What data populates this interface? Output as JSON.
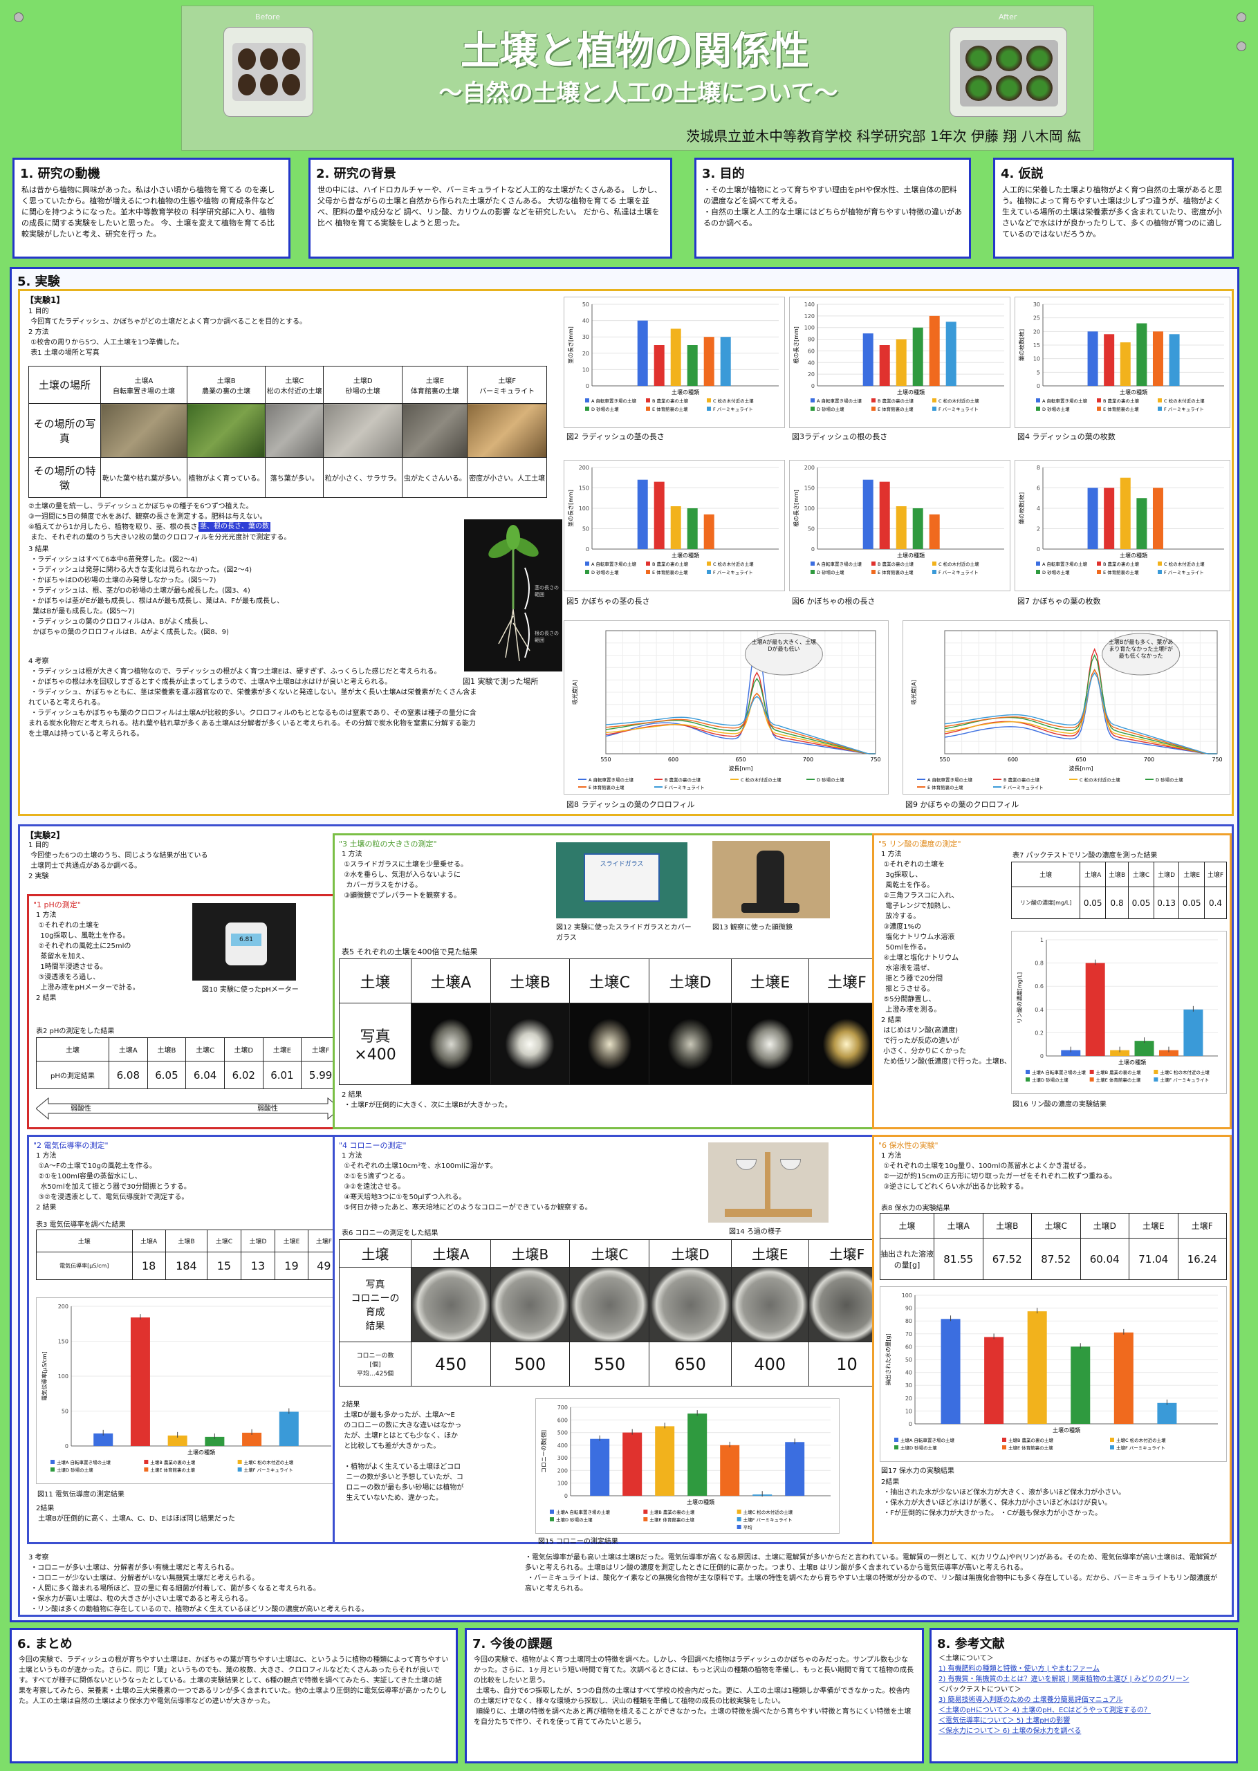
{
  "header": {
    "title": "土壌と植物の関係性",
    "subtitle": "～自然の土壌と人工の土壌について～",
    "author_line": "茨城県立並木中等教育学校 科学研究部 1年次 伊藤 翔 八木岡 紘",
    "before_label": "Before",
    "after_label": "After"
  },
  "sec1": {
    "title": "1. 研究の動機",
    "text": "私は昔から植物に興味があった。私は小さい頃から植物を育てる のを楽しく思っていたから。植物が増えるにつれ植物の生態や植物 の育成条件などに関心を持つようになった。並木中等教育学校の 科学研究部に入り、植物の成長に関する実験をしたいと思った。 今、土壌を変えて植物を育てる比較実験がしたいと考え、研究を行っ た。"
  },
  "sec2": {
    "title": "2. 研究の背景",
    "text": "世の中には、ハイドロカルチャーや、バーミキュライトなど人工的な土壌がたくさんある。 しかし、父母から昔ながらの土壌と自然から作られた土壌がたくさんある。 大切な植物を育てる 土壌を並べ、肥料の量や成分など 調べ、リン酸、カリウムの影響 などを研究したい。 だから、私達は土壌を比べ 植物を育てる実験をしようと思った。"
  },
  "sec3": {
    "title": "3. 目的",
    "text": "・その土壌が植物にとって育ちやすい理由をpHや保水性、土壌自体の肥料の濃度などを調べて考える。\n・自然の土壌と人工的な土壌にはどちらが植物が育ちやすい特徴の違いがあるのか調べる。"
  },
  "sec4": {
    "title": "4. 仮説",
    "text": "人工的に栄養した土壌より植物がよく育つ自然の土壌があると思う。植物によって育ちやすい土壌は少しずつ違うが、植物がよく生えている場所の土壌は栄養素が多く含まれていたり、密度が小さいなどで水はけが良かったりして、多くの植物が育つのに適しているのではないだろうか。"
  },
  "sec5": {
    "title": "5. 実験",
    "exp1_label": "【実験1】",
    "exp1_intro": "1 目的\n 今回育てたラディッシュ、かぼちゃがどの土壌だとよく育つか調べることを目的とする。\n2 方法\n ①校舎の周りから5つ、人工土壌を1つ準備した。\n 表1 土壌の場所と写真",
    "table1": {
      "row_labels": [
        "土壌の場所",
        "その場所の写真",
        "その場所の特徴"
      ],
      "cols": [
        {
          "name": "土壌A\n自転車置き場の土壌",
          "feature": "乾いた葉や枯れ葉が多い。"
        },
        {
          "name": "土壌B\n農業の裏の土壌",
          "feature": "植物がよく育っている。"
        },
        {
          "name": "土壌C\n松の木付近の土壌",
          "feature": "落ち葉が多い。"
        },
        {
          "name": "土壌D\n砂場の土壌",
          "feature": "粒が小さく、サラサラ。"
        },
        {
          "name": "土壌E\n体育館裏の土壌",
          "feature": "虫がたくさんいる。"
        },
        {
          "name": "土壌F\nバーミキュライト",
          "feature": "密度が小さい。人工土壌"
        }
      ]
    },
    "exp1_method2": "②土壌の量を統一し、ラディッシュとかぼちゃの種子を6つずつ植えた。\n③一週間に5日の頻度で水をあげ、観察の長さを測定する。肥料は与えない。\n④植えてから1か月したら、植物を取り、茎、根の長さ、葉の数を比較する。\n また、それぞれの葉のうち大きい2枚の葉のクロロフィルを分光光度計で測定する。",
    "highlight": "茎、根の長さ、葉の数",
    "exp1_result": "3 結果\n ・ラディッシュはすべて6本中6苗発芽した。(図2～4)\n ・ラディッシュは発芽に関わる大きな変化は見られなかった。(図2～4)\n ・かぼちゃはDの砂場の土壌のみ発芽しなかった。(図5～7)\n ・ラディッシュは、根、茎がDの砂場の土壌が最も成長した。(図3、4)\n ・かぼちゃは茎がEが最も成長し、根はAが最も成長し、葉はA、Fが最も成長し、\n  葉はBが最も成長した。(図5～7)\n ・ラディッシュの葉のクロロフィルはA、Bがよく成長し、\n  かぼちゃの葉のクロロフィルはB、Aがよく成長した。(図8、9)",
    "exp1_discussion": "4 考察\n ・ラディッシュは根が大きく育つ植物なので、ラディッシュの根がよく育つ土壌Eは、硬すぎず、ふっくらした感じだと考えられる。\n ・かぼちゃの根は水を回収しすぎるとすぐ成長が止まってしまうので、土壌Aや土壌Bは水はけが良いと考えられる。\n ・ラディッシュ、かぼちゃともに、茎は栄養素を運ぶ器官なので、栄養素が多くないと発達しない。茎が太く長い土壌Aは栄養素がたくさん含まれていると考えられる。\n ・ラディッシュもかぼちゃも葉のクロロフィルは土壌Aが比較的多い。クロロフィルのもととなるものは窒素であり、その窒素は種子の量分に含まれる炭水化物だと考えられる。枯れ葉や枯れ草が多くある土壌Aは分解者が多くいると考えられる。その分解で炭水化物を窒素に分解する能力を土壌Aは持っていると考えられる。",
    "fig1_caption": "図1 実験で測った場所",
    "fig1_label_stem": "茎の長さの範囲",
    "fig1_label_root": "根の長さの範囲"
  },
  "charts_exp1": {
    "xlabel": "土壌の種類",
    "legend": [
      "A 自転車置き場の土壌",
      "B 農業の裏の土壌",
      "C 松の木付近の土壌",
      "D 砂場の土壌",
      "E 体育館裏の土壌",
      "F バーミキュライト"
    ],
    "colors": [
      "#3b6ee0",
      "#e0322e",
      "#f2b21c",
      "#2f9a3f",
      "#f06a1e",
      "#3a9ad8"
    ],
    "fig2": {
      "caption": "図2 ラディッシュの茎の長さ",
      "ylabel": "茎の長さ[mm]",
      "ymax": 50,
      "ticks": [
        0,
        10,
        20,
        30,
        40,
        50
      ],
      "values": [
        40,
        25,
        35,
        25,
        30,
        30
      ]
    },
    "fig3": {
      "caption": "図3ラディッシュの根の長さ",
      "ylabel": "根の長さ[mm]",
      "ymax": 140,
      "ticks": [
        0,
        20,
        40,
        60,
        80,
        100,
        120,
        140
      ],
      "values": [
        90,
        70,
        80,
        100,
        120,
        110
      ]
    },
    "fig4": {
      "caption": "図4 ラディッシュの葉の枚数",
      "ylabel": "葉の枚数[枚]",
      "ymax": 30,
      "ticks": [
        0,
        5,
        10,
        15,
        20,
        25,
        30
      ],
      "values": [
        20,
        19,
        16,
        23,
        20,
        19
      ]
    },
    "fig5": {
      "caption": "図5 かぼちゃの茎の長さ",
      "ylabel": "茎の長さ[mm]",
      "ymax": 200,
      "ticks": [
        0,
        50,
        100,
        150,
        200
      ],
      "values": [
        170,
        165,
        105,
        100,
        85,
        0
      ]
    },
    "fig6": {
      "caption": "図6 かぼちゃの根の長さ",
      "ylabel": "根の長さ[mm]",
      "ymax": 200,
      "ticks": [
        0,
        50,
        100,
        150,
        200
      ],
      "values": [
        170,
        165,
        105,
        100,
        85,
        0
      ]
    },
    "fig7": {
      "caption": "図7 かぼちゃの葉の枚数",
      "ylabel": "葉の枚数[枚]",
      "ymax": 8,
      "ticks": [
        0,
        2,
        4,
        6,
        8
      ],
      "values": [
        6,
        6,
        7,
        5,
        6,
        0
      ]
    },
    "fig8": {
      "caption": "図8 ラディッシュの葉のクロロフィル",
      "bubble": "土壌Aが最も大きく、土壌Dが最も低い",
      "xlabel": "波長[nm]",
      "ylabel": "吸光度[A]"
    },
    "fig9": {
      "caption": "図9 かぼちゃの葉のクロロフィル",
      "bubble": "土壌Bが最も多く、葉があまり育たなかった土壌Fが最も低くなかった",
      "xlabel": "波長[nm]",
      "ylabel": "吸光度[A]"
    },
    "spectrum_x_ticks": [
      "550",
      "600",
      "650",
      "700",
      "750"
    ]
  },
  "exp2": {
    "label": "【実験2】",
    "intro": "1 目的\n 今回使った6つの土壌のうち、同じような結果が出ている\n 土壌同士で共通点があるか調べる。\n2 実験",
    "ph": {
      "title": "\"1 pHの測定\"",
      "method": "1 方法\n ①それぞれの土壌を\n  10g採取し、風乾土を作る。\n ②それぞれの風乾土に25mlの\n  蒸留水を加え、\n  1時間半浸透させる。\n ③浸透液をろ過し、\n  上澄み液をpHメーターで計る。\n2 結果",
      "fig10_caption": "図10 実験に使ったpHメーター",
      "meter_display": "6.81",
      "table_caption": "表2 pHの測定をした結果",
      "row_header": "土壌",
      "row_label": "pHの測定結果",
      "cols": [
        "土壌A",
        "土壌B",
        "土壌C",
        "土壌D",
        "土壌E",
        "土壌F"
      ],
      "values": [
        "6.08",
        "6.05",
        "6.04",
        "6.02",
        "6.01",
        "5.99"
      ],
      "arrow_left": "弱酸性",
      "arrow_right": "弱酸性"
    },
    "grain": {
      "title": "\"3 土壌の粒の大きさの測定\"",
      "method": "1 方法\n ①スライドガラスに土壌を少量乗せる。\n ②水を垂らし、気泡が入らないように\n  カバーガラスをかける。\n ③顕微鏡でプレパラートを観察する。",
      "fig12_caption": "図12 実験に使ったスライドガラスとカバーガラス",
      "fig12_label": "スライドガラス",
      "fig13_caption": "図13 観察に使った顕微鏡",
      "table_caption": "表5 それぞれの土壌を400倍で見た結果",
      "row_header": "土壌",
      "row_label": "写真\n×400",
      "cols": [
        "土壌A",
        "土壌B",
        "土壌C",
        "土壌D",
        "土壌E",
        "土壌F"
      ],
      "result": "2 結果\n ・土壌Fが圧倒的に大きく、次に土壌Bが大きかった。"
    },
    "phosphate": {
      "title": "\"5 リン酸の濃度の測定\"",
      "method": "1 方法\n ①それぞれの土壌を\n  3g採取し、\n  風乾土を作る。\n ②三角フラスコに入れ、\n  電子レンジで加熱し、\n  放冷する。\n ③濃度1%の\n  塩化ナトリウム水溶液\n  50mlを作る。\n ④土壌と塩化ナトリウム\n  水溶液を混ぜ、\n  振とう器で20分間\n  振とうさせる。\n ⑤5分間静置し、\n  上澄み液を測る。\n2 結果\n はじめはリン酸(高濃度)\n で行ったが反応の違いが\n 小さく、分かりにくかった\n ため低リン酸(低濃度)で行った。土壌B、Fが大きく反応した。",
      "table_caption": "表7 パックテストでリン酸の濃度を測った結果",
      "row_header": "土壌",
      "row_label": "リン酸の濃度[mg/L]",
      "cols": [
        "土壌A",
        "土壌B",
        "土壌C",
        "土壌D",
        "土壌E",
        "土壌F"
      ],
      "values": [
        "0.05",
        "0.8",
        "0.05",
        "0.13",
        "0.05",
        "0.4"
      ],
      "fig16_caption": "図16 リン酸の濃度の実験結果",
      "ylabel": "リン酸の濃度[mg/L]",
      "xlabel": "土壌の種類"
    },
    "conductivity": {
      "title": "\"2 電気伝導率の測定\"",
      "method": "1 方法\n ①A～Fの土壌で10gの風乾土を作る。\n ②①を100ml容量の蒸留水にし、\n  水50mlを加えて振とう器で30分間振とうする。\n ③②を浸透液として、電気伝導度計で測定する。\n2 結果",
      "table_caption": "表3 電気伝導率を調べた結果",
      "row_header": "土壌",
      "row_label": "電気伝導率[μS/cm]",
      "cols": [
        "土壌A",
        "土壌B",
        "土壌C",
        "土壌D",
        "土壌E",
        "土壌F"
      ],
      "values": [
        "18",
        "184",
        "15",
        "13",
        "19",
        "49"
      ],
      "fig11_caption": "図11 電気伝導度の測定結果",
      "ylabel": "電気伝導率[μS/cm]",
      "xlabel": "土壌の種類",
      "discussion": "2結果\n 土壌Bが圧倒的に高く、土壌A、C、D、Eはほぼ同じ結果だった"
    },
    "colony": {
      "title": "\"4 コロニーの測定\"",
      "method": "1 方法\n ①それぞれの土壌10cm³を、水100mlに溶かす。\n ②①を5滴ずつとる。\n ③②を遠沈させる。\n ④寒天培地3つに①を50μlずつ入れる。\n ⑤何日か待ったあと、寒天培地にどのようなコロニーができているか観察する。",
      "fig14_caption": "図14 ろ過の様子",
      "table_caption": "表6 コロニーの測定をした結果",
      "row_header": "土壌",
      "row_photo": "写真\nコロニーの\n育成\n結果",
      "row_count": "コロニーの数\n[個]\n平均…425個",
      "cols": [
        "土壌A",
        "土壌B",
        "土壌C",
        "土壌D",
        "土壌E",
        "土壌F"
      ],
      "values": [
        "450",
        "500",
        "550",
        "650",
        "400",
        "10"
      ],
      "result": "2結果\n 土壌Dが最も多かったが、土壌A～E\n のコロニーの数に大きな違いはなかっ\n たが、土壌Fとはとても少なく、ほか\n と比較しても差が大きかった。\n\n ・植物がよく生えている土壌ほどコロ\n  ニーの数が多いと予想していたが、コ\n  ロニーの数が最も多い砂場には植物が\n  生えていないため、違かった。",
      "fig15_caption": "図15 コロニーの測定結果",
      "ylabel": "コロニーの数[個]",
      "xlabel": "土壌の種類",
      "avg_label": "平均"
    },
    "water": {
      "title": "\"6 保水性の実験\"",
      "method": "1 方法\n ①それぞれの土壌を10g量り、100mlの蒸留水とよくかき混ぜる。\n ②一辺が約15cmの正方形に切り取ったガーゼをそれぞれ二枚ずつ重ねる。\n ③逆さにしてどれくらい水が出るか比較する。",
      "table_caption": "表8 保水力の実験結果",
      "row_header": "土壌",
      "row_label": "抽出された溶液の量[g]",
      "cols": [
        "土壌A",
        "土壌B",
        "土壌C",
        "土壌D",
        "土壌E",
        "土壌F"
      ],
      "values": [
        "81.55",
        "67.52",
        "87.52",
        "60.04",
        "71.04",
        "16.24"
      ],
      "fig17_caption": "図17 保水力の実験結果",
      "ylabel": "抽出された水の量[g]",
      "xlabel": "土壌の種類",
      "result": "2結果\n ・抽出された水が少ないほど保水力が大きく、液が多いほど保水力が小さい。\n ・保水力が大きいほど水はけが悪く、保水力が小さいほど水はけが良い。\n ・Fが圧倒的に保水力が大きかった。 ・Cが最も保水力が小さかった。"
    },
    "discussion_left": "3 考察\n ・コロニーが多い土壌は、分解者が多い有機土壌だと考えられる。\n ・コロニーが少ない土壌は、分解者がいない無機質土壌だと考えられる。\n ・人間に多く踏まれる場所ほど、豆の量に有る細菌が付着して、菌が多くなると考えられる。\n ・保水力が高い土壌は、粒の大きさが小さい土壌であると考えられる。\n ・リン酸は多くの動植物に存在しているので、植物がよく生えているほどリン酸の濃度が高いと考えられる。",
    "discussion_right": "・電気伝導率が最も高い土壌は土壌Bだった。電気伝導率が高くなる原因は、土壌に電解質が多いからだと言われている。電解質の一例として、K(カリウム)やP(リン)がある。そのため、電気伝導率が高い土壌Bは、電解質が多いと考えられる。土壌Bはリン酸の濃度を測定したときに圧倒的に高かった。つまり、土壌B はリン酸が多く含まれているから電気伝導率が高いと考えられる。\n ・バーミキュライトは、酸化ケイ素などの無機化合物が主な原料です。土壌の特性を調べたから育ちやすい土壌の特徴が分かるので、リン酸は無機化合物中にも多く存在している。だから、バーミキュライトもリン酸濃度が高いと考えられる。"
  },
  "sec6": {
    "title": "6. まとめ",
    "text": "今回の実験で、ラディッシュの根が育ちやすい土壌はE、かぼちゃの葉が育ちやすい土壌はC、というように植物の種類によって育ちやすい土壌というものが違かった。さらに、同じ「葉」というものでも、葉の枚数、大きさ、クロロフィルなどたくさんあったらそれが良いです。すべてが様子に関係ないというなったとしている。土壌の実験結果として、6種の観点で特徴を調べてみたら、実証してきた土壌の結果を考察してみたら、栄養素・土壌の三大栄養素の一つであるリンが多く含まれていた。他の土壌より圧倒的に電気伝導率が高かったりした。人工の土壌は自然の土壌はより保水力や電気伝導率などの違いが大きかった。"
  },
  "sec7": {
    "title": "7. 今後の課題",
    "text": "今回の実験で、植物がよく育つ土壌同士の特徴を調べた。しかし、今回調べた植物はラディッシュのかぼちゃのみだった。サンプル数も少なかった。さらに、1ヶ月という短い時間で育てた。次調べるときには、もっと沢山の種類の植物を準備し、もっと長い期間で育てて植物の成長の比較をしたいと思う。\n 土壌も、自分で6つ採取したが、5つの自然の土壌はすべて学校の校舎内だった。更に、人工の土壌は1種類しか準備ができなかった。校舎内の土壌だけでなく、様々な環境から採取し、沢山の種類を準備して植物の成長の比較実験をしたい。\n 順繰りに、土壌の特徴を調べたあと再び植物を植えることができなかった。土壌の特徴を調べたから育ちやすい特徴と育ちにくい特徴を土壌を自分たちで作り、それを使って育ててみたいと思う。"
  },
  "sec8": {
    "title": "8. 参考文献",
    "refs": [
      "＜土壌について＞",
      "1) 有機肥料の種類と特徴・使い方 | やまむファーム",
      "2) 有機質・無機質の土とは？違いを解説 | 関東植物の土選び | みどりのグリーン",
      "＜パックテストについて＞",
      "3) 簡易技術導入判断のための 土壌養分簡易評価マニュアル",
      "＜土壌のpHについて＞ 4) 土壌のpH、ECはどうやって測定するの？",
      "＜電気伝導率について＞ 5) 土壌pHの影響",
      "＜保水力について＞ 6) 土壌の保水力を調べる"
    ]
  },
  "exp2_charts": {
    "legend": [
      "土壌A 自転車置き場の土壌",
      "土壌B 農業の裏の土壌",
      "土壌C 松の木付近の土壌",
      "土壌D 砂場の土壌",
      "土壌E 体育館裏の土壌",
      "土壌F バーミキュライト"
    ]
  },
  "chart_data": [
    {
      "type": "bar",
      "title": "図2 ラディッシュの茎の長さ",
      "xlabel": "土壌の種類",
      "ylabel": "茎の長さ[mm]",
      "categories": [
        "A",
        "B",
        "C",
        "D",
        "E",
        "F"
      ],
      "values": [
        40,
        25,
        35,
        25,
        30,
        30
      ],
      "ylim": [
        0,
        50
      ]
    },
    {
      "type": "bar",
      "title": "図3ラディッシュの根の長さ",
      "xlabel": "土壌の種類",
      "ylabel": "根の長さ[mm]",
      "categories": [
        "A",
        "B",
        "C",
        "D",
        "E",
        "F"
      ],
      "values": [
        90,
        70,
        80,
        100,
        120,
        110
      ],
      "ylim": [
        0,
        140
      ]
    },
    {
      "type": "bar",
      "title": "図4 ラディッシュの葉の枚数",
      "xlabel": "土壌の種類",
      "ylabel": "葉の枚数[枚]",
      "categories": [
        "A",
        "B",
        "C",
        "D",
        "E",
        "F"
      ],
      "values": [
        20,
        19,
        16,
        23,
        20,
        19
      ],
      "ylim": [
        0,
        30
      ]
    },
    {
      "type": "bar",
      "title": "図5 かぼちゃの茎の長さ",
      "xlabel": "土壌の種類",
      "ylabel": "茎の長さ[mm]",
      "categories": [
        "A",
        "B",
        "C",
        "D",
        "E",
        "F"
      ],
      "values": [
        170,
        165,
        105,
        100,
        85,
        0
      ],
      "ylim": [
        0,
        200
      ]
    },
    {
      "type": "bar",
      "title": "図6 かぼちゃの根の長さ",
      "xlabel": "土壌の種類",
      "ylabel": "根の長さ[mm]",
      "categories": [
        "A",
        "B",
        "C",
        "D",
        "E",
        "F"
      ],
      "values": [
        170,
        165,
        105,
        100,
        85,
        0
      ],
      "ylim": [
        0,
        200
      ]
    },
    {
      "type": "bar",
      "title": "図7 かぼちゃの葉の枚数",
      "xlabel": "土壌の種類",
      "ylabel": "葉の枚数[枚]",
      "categories": [
        "A",
        "B",
        "C",
        "D",
        "E",
        "F"
      ],
      "values": [
        6,
        6,
        7,
        5,
        6,
        0
      ],
      "ylim": [
        0,
        8
      ]
    },
    {
      "type": "bar",
      "title": "図11 電気伝導度の測定結果",
      "xlabel": "土壌の種類",
      "categories": [
        "A",
        "B",
        "C",
        "D",
        "E",
        "F"
      ],
      "values": [
        18,
        184,
        15,
        13,
        19,
        49
      ],
      "ylim": [
        0,
        200
      ]
    },
    {
      "type": "bar",
      "title": "図15 コロニーの測定結果",
      "xlabel": "土壌の種類",
      "categories": [
        "A",
        "B",
        "C",
        "D",
        "E",
        "F",
        "平均"
      ],
      "values": [
        450,
        500,
        550,
        650,
        400,
        10,
        425
      ],
      "ylim": [
        0,
        700
      ]
    },
    {
      "type": "bar",
      "title": "図16 リン酸の濃度の実験結果",
      "xlabel": "土壌の種類",
      "categories": [
        "A",
        "B",
        "C",
        "D",
        "E",
        "F"
      ],
      "values": [
        0.05,
        0.8,
        0.05,
        0.13,
        0.05,
        0.4
      ],
      "ylim": [
        0,
        1
      ]
    },
    {
      "type": "bar",
      "title": "図17 保水力の実験結果",
      "xlabel": "土壌の種類",
      "categories": [
        "A",
        "B",
        "C",
        "D",
        "E",
        "F"
      ],
      "values": [
        81.55,
        67.52,
        87.52,
        60.04,
        71.04,
        16.24
      ],
      "ylim": [
        0,
        100
      ]
    }
  ]
}
